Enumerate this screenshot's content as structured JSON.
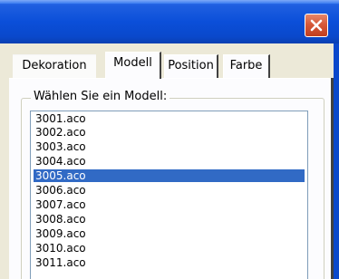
{
  "window": {
    "close_icon": "close-icon",
    "title_color": "#0b4fd9",
    "close_color": "#d65a3a"
  },
  "tabs": [
    {
      "label": "Dekoration",
      "active": false
    },
    {
      "label": "Modell",
      "active": true
    },
    {
      "label": "Position",
      "active": false
    },
    {
      "label": "Farbe",
      "active": false
    }
  ],
  "group": {
    "label": "Wählen Sie ein Modell:"
  },
  "models": {
    "items": [
      "3001.aco",
      "3002.aco",
      "3003.aco",
      "3004.aco",
      "3005.aco",
      "3006.aco",
      "3007.aco",
      "3008.aco",
      "3009.aco",
      "3010.aco",
      "3011.aco"
    ],
    "selected": "3005.aco",
    "selection_color": "#316ac5"
  }
}
